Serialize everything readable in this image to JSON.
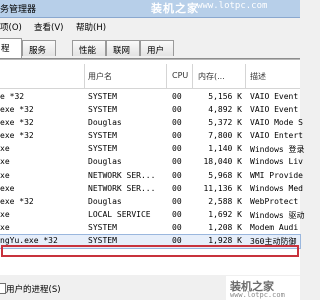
{
  "window": {
    "title": "务管理器"
  },
  "watermark": {
    "site_name": "装机之家",
    "url": "www.lotpc.com"
  },
  "menu": {
    "items": [
      "项(O)",
      "查看(V)",
      "帮助(H)"
    ]
  },
  "tabs": [
    "程",
    "服务",
    "性能",
    "联网",
    "用户"
  ],
  "table": {
    "columns": [
      "",
      "用户名",
      "CPU",
      "内存(...",
      "描述"
    ],
    "rows": [
      {
        "image": "e *32",
        "user": "SYSTEM",
        "cpu": "00",
        "mem": "5,156 K",
        "desc": "VAIO Event"
      },
      {
        "image": "exe *32",
        "user": "SYSTEM",
        "cpu": "00",
        "mem": "4,892 K",
        "desc": "VAIO Event"
      },
      {
        "image": "exe *32",
        "user": "Douglas",
        "cpu": "00",
        "mem": "5,372 K",
        "desc": "VAIO Mode S"
      },
      {
        "image": "exe *32",
        "user": "SYSTEM",
        "cpu": "00",
        "mem": "7,800 K",
        "desc": "VAIO Entert"
      },
      {
        "image": "xe",
        "user": "SYSTEM",
        "cpu": "00",
        "mem": "1,140 K",
        "desc": "Windows 登录"
      },
      {
        "image": "xe",
        "user": "Douglas",
        "cpu": "00",
        "mem": "18,040 K",
        "desc": "Windows Liv"
      },
      {
        "image": "xe",
        "user": "NETWORK SER...",
        "cpu": "00",
        "mem": "5,968 K",
        "desc": "WMI Provide"
      },
      {
        "image": "exe",
        "user": "NETWORK SER...",
        "cpu": "00",
        "mem": "11,136 K",
        "desc": "Windows Med"
      },
      {
        "image": "exe *32",
        "user": "Douglas",
        "cpu": "00",
        "mem": "2,588 K",
        "desc": "WebProtect"
      },
      {
        "image": "xe",
        "user": "LOCAL SERVICE",
        "cpu": "00",
        "mem": "1,692 K",
        "desc": "Windows 驱动"
      },
      {
        "image": "xe",
        "user": "SYSTEM",
        "cpu": "00",
        "mem": "1,208 K",
        "desc": "Modem Audi"
      },
      {
        "image": "ngYu.exe *32",
        "user": "SYSTEM",
        "cpu": "00",
        "mem": "1,928 K",
        "desc": "360主动防御"
      }
    ]
  },
  "footer": {
    "show_all_label": "用户的进程(S)"
  }
}
